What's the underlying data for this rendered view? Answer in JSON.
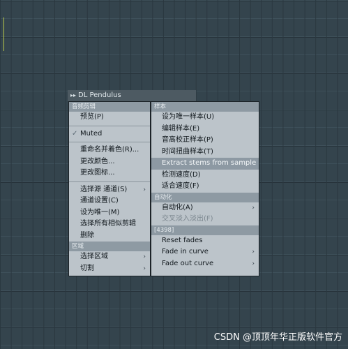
{
  "window": {
    "title": "DL Pendulus"
  },
  "left_column": {
    "section_audio_clip": "音频剪辑",
    "preview": "预览(P)",
    "muted": "Muted",
    "rename_color": "重命名并着色(R)...",
    "change_color": "更改颜色...",
    "change_icon": "更改图标...",
    "select_source_channel": "选择源 通道(S)",
    "channel_settings": "通道设置(C)",
    "make_unique": "设为唯一(M)",
    "select_similar_clips": "选择所有相似剪辑",
    "delete": "删除",
    "section_region": "区域",
    "select_region": "选择区域",
    "slice": "切割"
  },
  "right_column": {
    "section_sample": "样本",
    "make_unique_sample": "设为唯一样本(U)",
    "edit_sample": "编辑样本(E)",
    "pitch_correct_sample": "音高校正样本(P)",
    "time_stretch_sample": "时间扭曲样本(T)",
    "extract_stems": "Extract stems from sample",
    "detect_tempo": "检测速度(D)",
    "fit_tempo": "适合速度(F)",
    "section_automation": "自动化",
    "automation": "自动化(A)",
    "crossfade": "交叉淡入淡出(F)",
    "section_4398": "[4398]",
    "reset_fades": "Reset fades",
    "fade_in_curve": "Fade in curve",
    "fade_out_curve": "Fade out curve"
  },
  "icons": {
    "title_icon": "double-arrow-icon",
    "check": "check-icon",
    "submenu": "chevron-right-icon"
  },
  "watermark": "CSDN @顶顶年华正版软件官方",
  "colors": {
    "background": "#34444d",
    "menu_bg": "#bcc4ca",
    "section_header": "#8e9aa3",
    "highlight": "#8d99a3",
    "title_bar": "#4d5a62"
  }
}
